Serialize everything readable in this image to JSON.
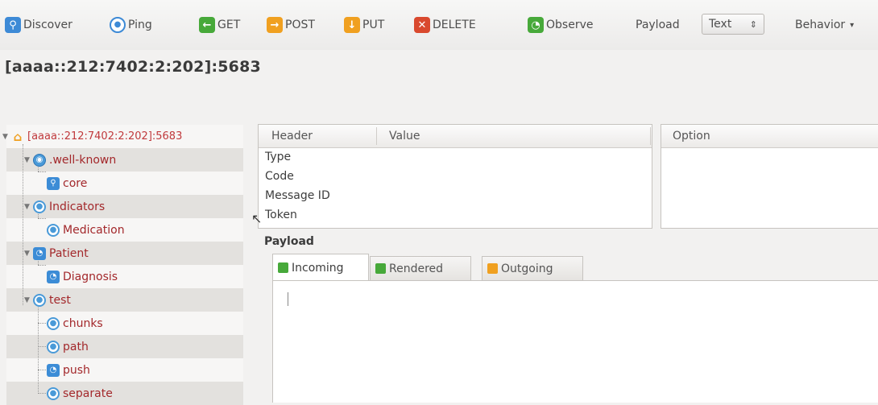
{
  "toolbar": {
    "discover": "Discover",
    "ping": "Ping",
    "get": "GET",
    "post": "POST",
    "put": "PUT",
    "delete": "DELETE",
    "observe": "Observe",
    "payload_label": "Payload",
    "payload_format": "Text",
    "behavior": "Behavior"
  },
  "address": "[aaaa::212:7402:2:202]:5683",
  "tree": {
    "root": "[aaaa::212:7402:2:202]:5683",
    "well_known": ".well-known",
    "core": "core",
    "indicators": "Indicators",
    "medication": "Medication",
    "patient": "Patient",
    "diagnosis": "Diagnosis",
    "test": "test",
    "chunks": "chunks",
    "path": "path",
    "push": "push",
    "separate": "separate"
  },
  "header_table": {
    "col_header": "Header",
    "col_value": "Value",
    "rows": [
      "Type",
      "Code",
      "Message ID",
      "Token"
    ]
  },
  "option_table": {
    "col_option": "Option"
  },
  "payload": {
    "label": "Payload",
    "tabs": [
      "Incoming",
      "Rendered",
      "Outgoing"
    ]
  },
  "colors": {
    "link_red": "#a3282b",
    "accent_blue": "#3d8ad6",
    "green": "#47a93a",
    "orange": "#f0a020"
  }
}
